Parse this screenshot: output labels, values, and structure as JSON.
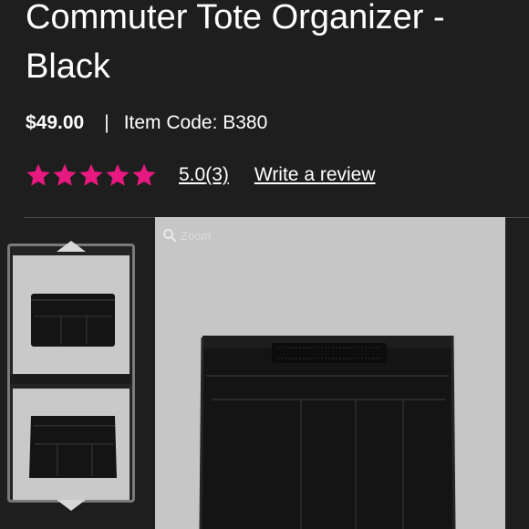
{
  "product": {
    "title": "Commuter Tote Organizer - Black",
    "price": "$49.00",
    "separator": "|",
    "item_code": "Item Code: B380",
    "rating_value": "5.0",
    "rating_count": "(3)",
    "write_review": "Write a review",
    "stars": 5
  },
  "gallery": {
    "zoom_label": "Zoom",
    "icons": {
      "zoom": "magnifier-icon",
      "up": "chevron-up-icon",
      "down": "chevron-down-icon"
    }
  },
  "colors": {
    "star": "#e5197f",
    "background": "#1e1e1e",
    "image_bg": "#c6c6c6"
  }
}
